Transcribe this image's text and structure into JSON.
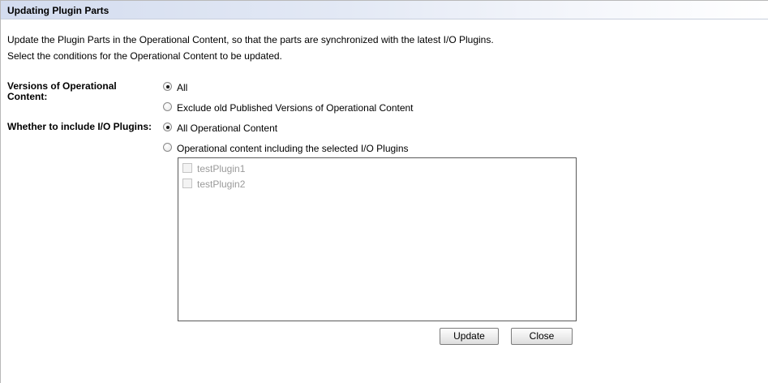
{
  "dialog": {
    "title": "Updating Plugin Parts",
    "description": [
      "Update the Plugin Parts in the Operational Content, so that the parts are synchronized with the latest I/O Plugins.",
      "Select the conditions for the Operational Content to be updated."
    ]
  },
  "versions": {
    "label": "Versions of Operational Content:",
    "options": [
      {
        "label": "All",
        "checked": true
      },
      {
        "label": "Exclude old Published Versions of Operational Content",
        "checked": false
      }
    ]
  },
  "include_plugins": {
    "label": "Whether to include I/O Plugins:",
    "options": [
      {
        "label": "All Operational Content",
        "checked": true
      },
      {
        "label": "Operational content including the selected I/O Plugins",
        "checked": false
      }
    ]
  },
  "plugin_list": {
    "items": [
      {
        "label": "testPlugin1",
        "checked": false,
        "disabled": true
      },
      {
        "label": "testPlugin2",
        "checked": false,
        "disabled": true
      }
    ]
  },
  "buttons": {
    "update": "Update",
    "close": "Close"
  }
}
